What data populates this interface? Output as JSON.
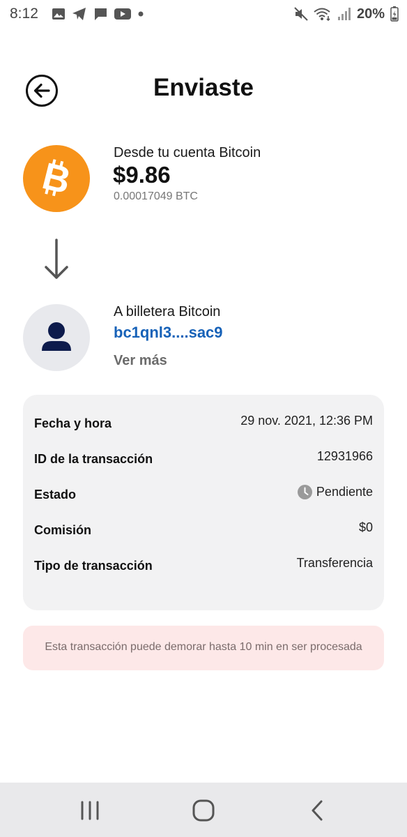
{
  "status_bar": {
    "time": "8:12",
    "battery": "20%",
    "left_icons": [
      "gallery-icon",
      "telegram-icon",
      "message-icon",
      "youtube-icon",
      "dot-icon"
    ],
    "right_icons": [
      "mute-icon",
      "wifi-icon",
      "signal-icon",
      "battery-icon"
    ]
  },
  "header": {
    "title": "Enviaste",
    "back_icon": "back-arrow-circle-icon"
  },
  "from": {
    "label": "Desde tu cuenta Bitcoin",
    "amount": "$9.86",
    "btc_amount": "0.00017049 BTC",
    "icon": "bitcoin-icon",
    "icon_color": "#F7931A"
  },
  "to": {
    "label": "A billetera Bitcoin",
    "address": "bc1qnl3....sac9",
    "see_more": "Ver más",
    "icon": "person-icon",
    "address_color": "#1762B8"
  },
  "details": [
    {
      "label": "Fecha y hora",
      "value": "29 nov. 2021, 12:36 PM"
    },
    {
      "label": "ID de la transacción",
      "value": "12931966"
    },
    {
      "label": "Estado",
      "value": "Pendiente",
      "icon": "clock-icon"
    },
    {
      "label": "Comisión",
      "value": "$0"
    },
    {
      "label": "Tipo de transacción",
      "value": "Transferencia"
    }
  ],
  "notice": {
    "text": "Esta transacción puede demorar hasta 10 min en ser procesada",
    "background": "#FDE8E8"
  },
  "nav_bar": {
    "buttons": [
      "recent-apps-icon",
      "home-icon",
      "back-icon"
    ]
  }
}
